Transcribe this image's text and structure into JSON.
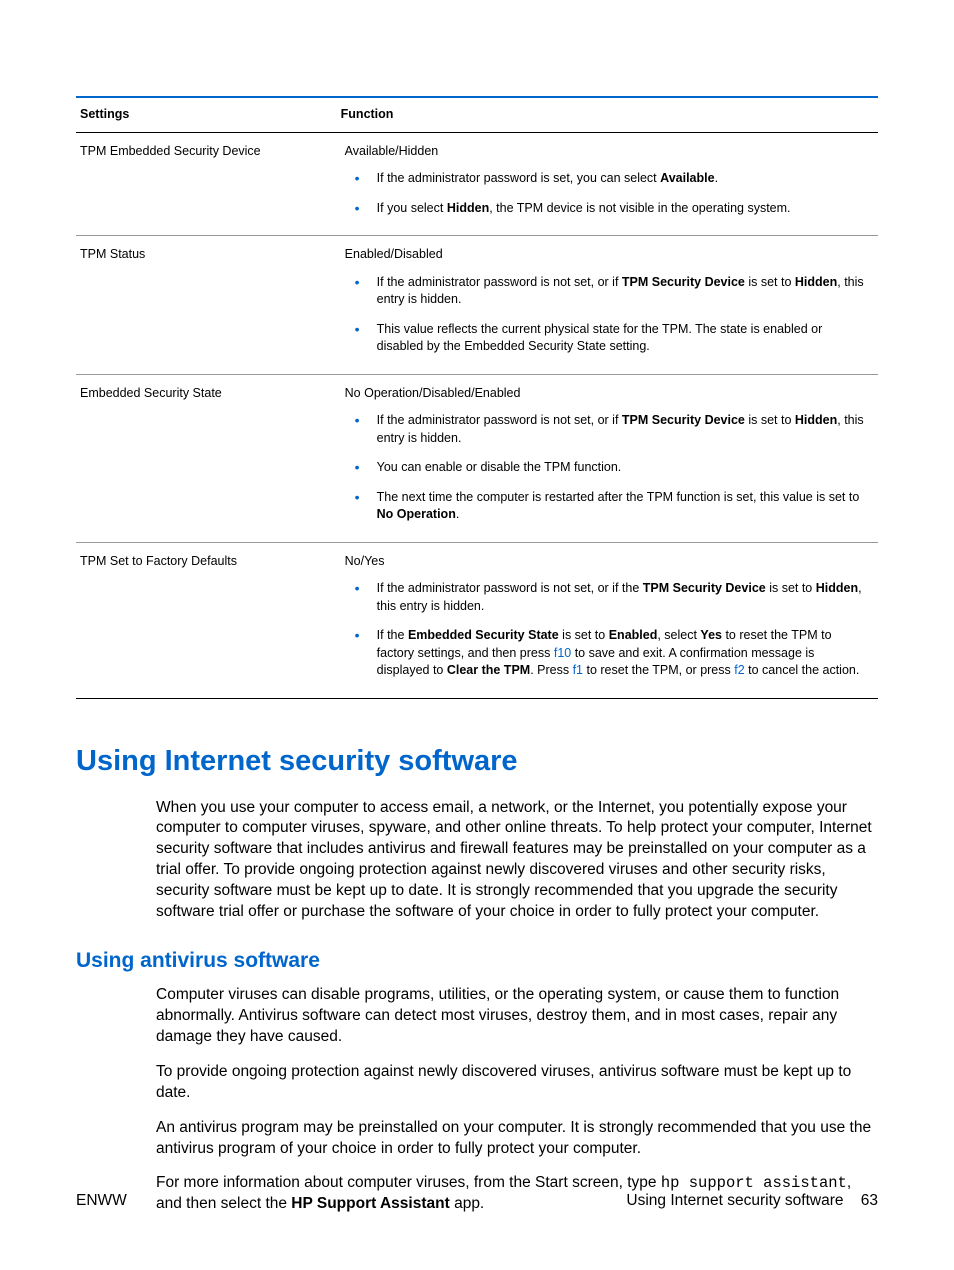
{
  "table": {
    "headers": {
      "col1": "Settings",
      "col2": "Function"
    },
    "rows": [
      {
        "setting": "TPM Embedded Security Device",
        "options": "Available/Hidden",
        "bullets": [
          [
            {
              "t": "If the administrator password is set, you can select "
            },
            {
              "t": "Available",
              "bold": true
            },
            {
              "t": "."
            }
          ],
          [
            {
              "t": "If you select "
            },
            {
              "t": "Hidden",
              "bold": true
            },
            {
              "t": ", the TPM device is not visible in the operating system."
            }
          ]
        ]
      },
      {
        "setting": "TPM Status",
        "options": "Enabled/Disabled",
        "bullets": [
          [
            {
              "t": "If the administrator password is not set, or if "
            },
            {
              "t": "TPM Security Device",
              "bold": true
            },
            {
              "t": " is set to "
            },
            {
              "t": "Hidden",
              "bold": true
            },
            {
              "t": ", this entry is hidden."
            }
          ],
          [
            {
              "t": "This value reflects the current physical state for the TPM. The state is enabled or disabled by the Embedded Security State setting."
            }
          ]
        ]
      },
      {
        "setting": "Embedded Security State",
        "options": "No Operation/Disabled/Enabled",
        "bullets": [
          [
            {
              "t": "If the administrator password is not set, or if "
            },
            {
              "t": "TPM Security Device",
              "bold": true
            },
            {
              "t": " is set to "
            },
            {
              "t": "Hidden",
              "bold": true
            },
            {
              "t": ", this entry is hidden."
            }
          ],
          [
            {
              "t": "You can enable or disable the TPM function."
            }
          ],
          [
            {
              "t": "The next time the computer is restarted after the TPM function is set, this value is set to "
            },
            {
              "t": "No Operation",
              "bold": true
            },
            {
              "t": "."
            }
          ]
        ]
      },
      {
        "setting": "TPM Set to Factory Defaults",
        "options": "No/Yes",
        "bullets": [
          [
            {
              "t": "If the administrator password is not set, or if the "
            },
            {
              "t": "TPM Security Device",
              "bold": true
            },
            {
              "t": " is set to "
            },
            {
              "t": "Hidden",
              "bold": true
            },
            {
              "t": ", this entry is hidden."
            }
          ],
          [
            {
              "t": "If the "
            },
            {
              "t": "Embedded Security State",
              "bold": true
            },
            {
              "t": " is set to "
            },
            {
              "t": "Enabled",
              "bold": true
            },
            {
              "t": ", select "
            },
            {
              "t": "Yes",
              "bold": true
            },
            {
              "t": " to reset the TPM to factory settings, and then press "
            },
            {
              "t": "f10",
              "key": true
            },
            {
              "t": " to save and exit. A confirmation message is displayed to "
            },
            {
              "t": "Clear the TPM",
              "bold": true
            },
            {
              "t": ". Press "
            },
            {
              "t": "f1",
              "key": true
            },
            {
              "t": " to reset the TPM, or press "
            },
            {
              "t": "f2",
              "key": true
            },
            {
              "t": " to cancel the action."
            }
          ]
        ]
      }
    ]
  },
  "h1": "Using Internet security software",
  "p1": "When you use your computer to access email, a network, or the Internet, you potentially expose your computer to computer viruses, spyware, and other online threats. To help protect your computer, Internet security software that includes antivirus and firewall features may be preinstalled on your computer as a trial offer. To provide ongoing protection against newly discovered viruses and other security risks, security software must be kept up to date. It is strongly recommended that you upgrade the security software trial offer or purchase the software of your choice in order to fully protect your computer.",
  "h2": "Using antivirus software",
  "p2": "Computer viruses can disable programs, utilities, or the operating system, or cause them to function abnormally. Antivirus software can detect most viruses, destroy them, and in most cases, repair any damage they have caused.",
  "p3": "To provide ongoing protection against newly discovered viruses, antivirus software must be kept up to date.",
  "p4": "An antivirus program may be preinstalled on your computer. It is strongly recommended that you use the antivirus program of your choice in order to fully protect your computer.",
  "p5": {
    "pre": "For more information about computer viruses, from the Start screen, type ",
    "mono": "hp support assistant",
    "mid": ", and then select the ",
    "bold": "HP Support Assistant",
    "post": " app."
  },
  "footer": {
    "left": "ENWW",
    "rightLabel": "Using Internet security software",
    "pageNum": "63"
  }
}
